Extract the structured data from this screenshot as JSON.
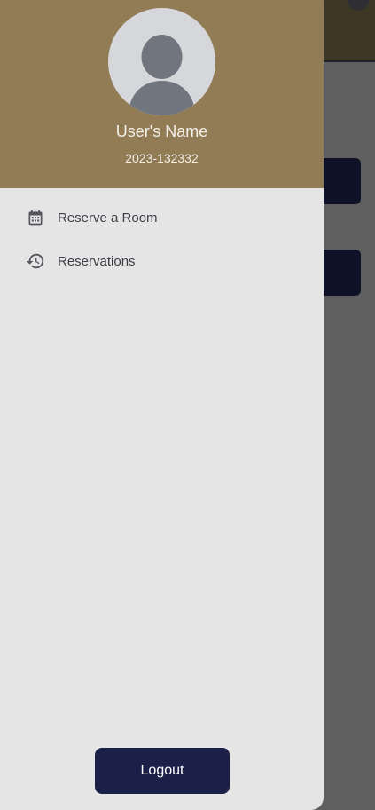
{
  "drawer": {
    "profile": {
      "name": "User's Name",
      "id": "2023-132332"
    },
    "menu": [
      {
        "label": "Reserve a Room",
        "icon": "calendar-icon"
      },
      {
        "label": "Reservations",
        "icon": "history-icon"
      }
    ],
    "logout_label": "Logout"
  },
  "colors": {
    "header": "#927c55",
    "drawer_bg": "#e5e5e6",
    "button": "#1b2048",
    "scrim": "#5f5f5f"
  }
}
